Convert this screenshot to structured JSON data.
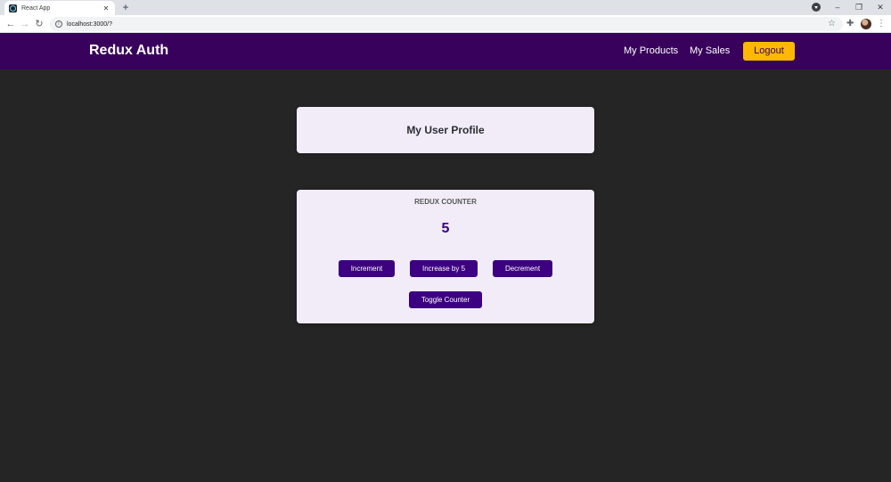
{
  "browser": {
    "tab_title": "React App",
    "tab_close": "✕",
    "new_tab": "+",
    "url": "localhost:3000/?",
    "back": "←",
    "forward": "→",
    "reload": "↻",
    "star": "☆",
    "extensions": "✚",
    "menu": "⋮",
    "window_controls": {
      "minimize": "–",
      "restore": "❐",
      "close": "✕"
    }
  },
  "header": {
    "brand": "Redux Auth",
    "nav": [
      {
        "label": "My Products"
      },
      {
        "label": "My Sales"
      }
    ],
    "logout_label": "Logout"
  },
  "profile": {
    "title": "My User Profile"
  },
  "counter": {
    "heading": "Redux Counter",
    "value": "5",
    "buttons": {
      "increment": "Increment",
      "increase": "Increase by 5",
      "decrement": "Decrement",
      "toggle": "Toggle Counter"
    }
  },
  "colors": {
    "header_bg": "#38015c",
    "accent": "#3c0080",
    "logout_bg": "#ffb800",
    "page_bg": "#252525",
    "card_bg": "#f1ecf8"
  }
}
